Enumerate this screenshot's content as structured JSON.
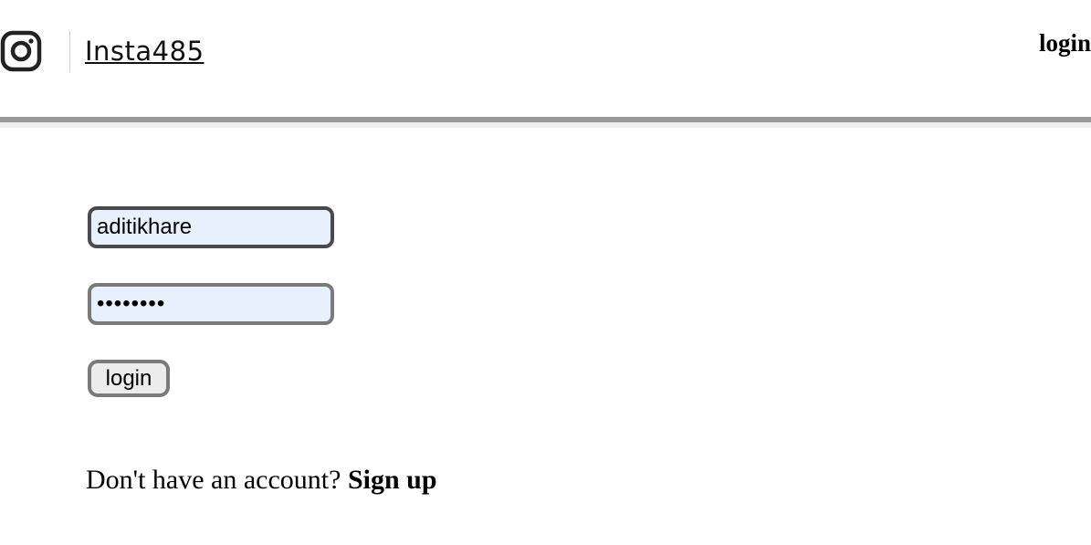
{
  "header": {
    "logo_icon": "instagram-icon",
    "brand": "Insta485",
    "nav_login_label": "login"
  },
  "login_form": {
    "username_value": "aditikhare",
    "password_value": "aditikha",
    "submit_label": "login"
  },
  "signup": {
    "prompt": "Don't have an account?",
    "link_label": "Sign up"
  }
}
